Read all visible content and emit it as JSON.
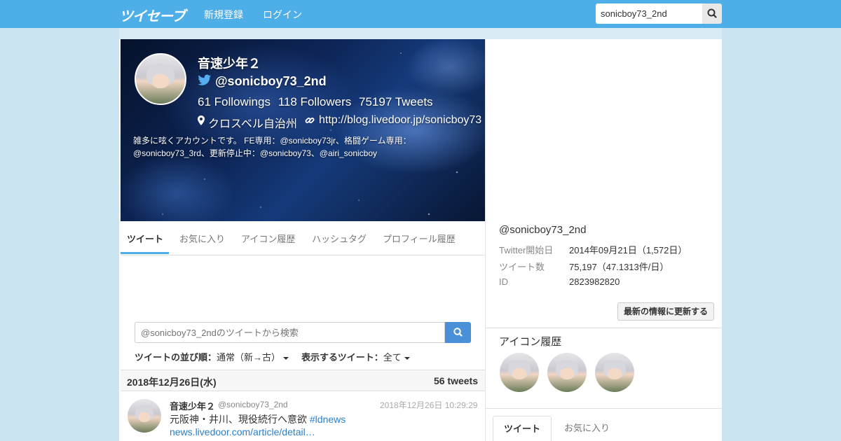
{
  "header": {
    "logo": "ツイセーブ",
    "nav": {
      "signup": "新規登録",
      "login": "ログイン"
    },
    "search_value": "sonicboy73_2nd"
  },
  "profile": {
    "name": "音速少年２",
    "handle": "@sonicboy73_2nd",
    "stats": {
      "followings": "61 Followings",
      "followers": "118 Followers",
      "tweets": "75197 Tweets"
    },
    "location": "クロスベル自治州",
    "url": "http://blog.livedoor.jp/sonicboy73",
    "bio": "雑多に呟くアカウントです。 FE専用：@sonicboy73jr、格闘ゲーム専用：@sonicboy73_3rd、更新停止中：@sonicboy73、@airi_sonicboy"
  },
  "tabs": [
    "ツイート",
    "お気に入り",
    "アイコン履歴",
    "ハッシュタグ",
    "プロフィール履歴"
  ],
  "tweet_search": {
    "placeholder": "@sonicboy73_2ndのツイートから検索"
  },
  "sort": {
    "order_label": "ツイートの並び順：",
    "order_value": "通常（新→古）",
    "display_label": "表示するツイート：",
    "display_value": "全て"
  },
  "date_group": {
    "date": "2018年12月26日(水)",
    "count": "56 tweets"
  },
  "tweet": {
    "name": "音速少年２",
    "handle": "@sonicboy73_2nd",
    "time": "2018年12月26日 10:29:29",
    "text_prefix": "元阪神・井川、現役続行へ意欲 ",
    "hashtag": "#ldnews",
    "link": " news.livedoor.com/article/detail…"
  },
  "info": {
    "handle": "@sonicboy73_2nd",
    "rows": [
      {
        "key": "Twitter開始日",
        "value": "2014年09月21日（1,572日）"
      },
      {
        "key": "ツイート数",
        "value": "75,197（47.1313件/日）"
      },
      {
        "key": "ID",
        "value": "2823982820"
      }
    ],
    "refresh_label": "最新の情報に更新する"
  },
  "icon_history": {
    "title": "アイコン履歴"
  },
  "right_tabs": [
    "ツイート",
    "お気に入り"
  ],
  "colors": {
    "nav": "#4eaee8",
    "page_bg": "#cbe4f1",
    "link": "#2a7fc9",
    "search_btn": "#4a90d9"
  },
  "icons": [
    "search-icon",
    "twitter-bird-icon",
    "map-marker-icon",
    "link-icon",
    "caret-down-icon"
  ]
}
